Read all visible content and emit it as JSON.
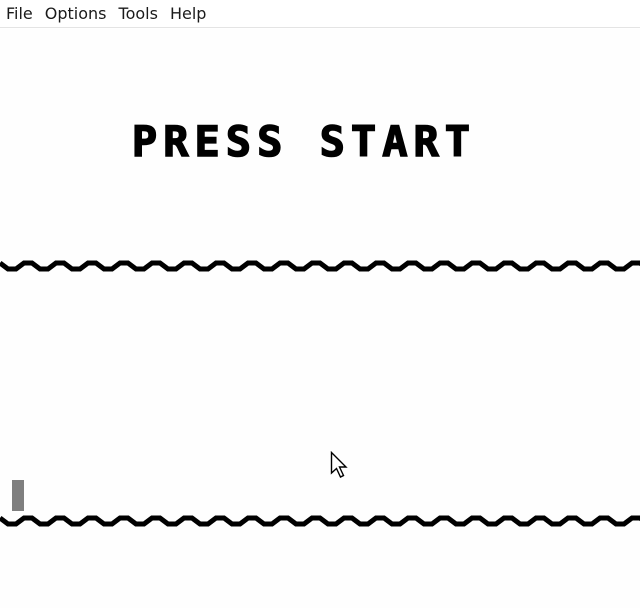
{
  "menubar": {
    "items": [
      {
        "label": "File"
      },
      {
        "label": "Options"
      },
      {
        "label": "Tools"
      },
      {
        "label": "Help"
      }
    ]
  },
  "game": {
    "title": "PRESS START",
    "wave_icon": "zigzag-border",
    "paddle_color": "#7f7f7f",
    "background_color": "#fefefe",
    "foreground_color": "#000000"
  },
  "cursor": {
    "icon": "arrow-cursor-icon"
  }
}
